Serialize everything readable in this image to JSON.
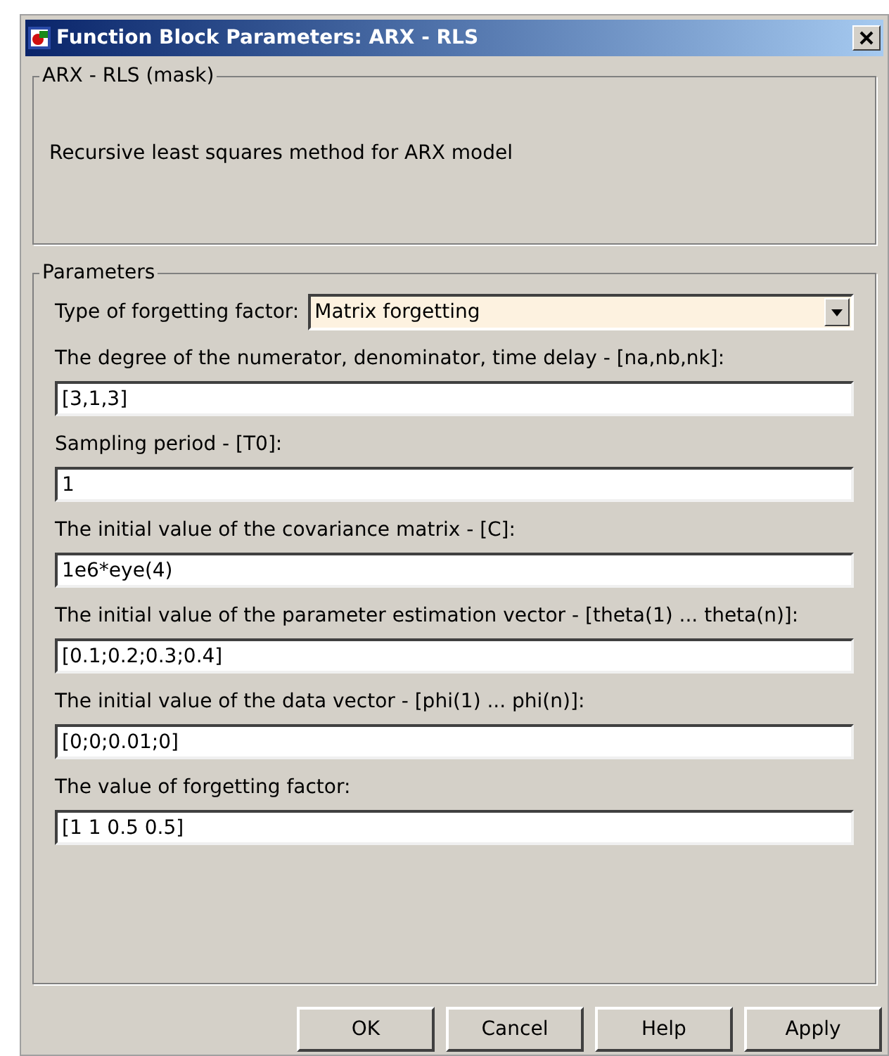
{
  "window": {
    "title": "Function Block Parameters: ARX - RLS"
  },
  "description_group": {
    "title": "ARX - RLS (mask)",
    "text": "Recursive least squares method for ARX model"
  },
  "parameters_group": {
    "title": "Parameters",
    "dropdown": {
      "label": "Type of forgetting factor:",
      "value": "Matrix forgetting"
    },
    "fields": [
      {
        "label": "The degree of the numerator, denominator, time delay - [na,nb,nk]:",
        "value": "[3,1,3]"
      },
      {
        "label": "Sampling period - [T0]:",
        "value": "1"
      },
      {
        "label": "The initial value of the covariance matrix - [C]:",
        "value": "1e6*eye(4)"
      },
      {
        "label": "The initial value of the parameter estimation vector - [theta(1) ... theta(n)]:",
        "value": "[0.1;0.2;0.3;0.4]"
      },
      {
        "label": "The initial value of the data vector - [phi(1) ... phi(n)]:",
        "value": "[0;0;0.01;0]"
      },
      {
        "label": "The value of forgetting factor:",
        "value": "[1 1 0.5 0.5]"
      }
    ]
  },
  "buttons": [
    "OK",
    "Cancel",
    "Help",
    "Apply"
  ]
}
